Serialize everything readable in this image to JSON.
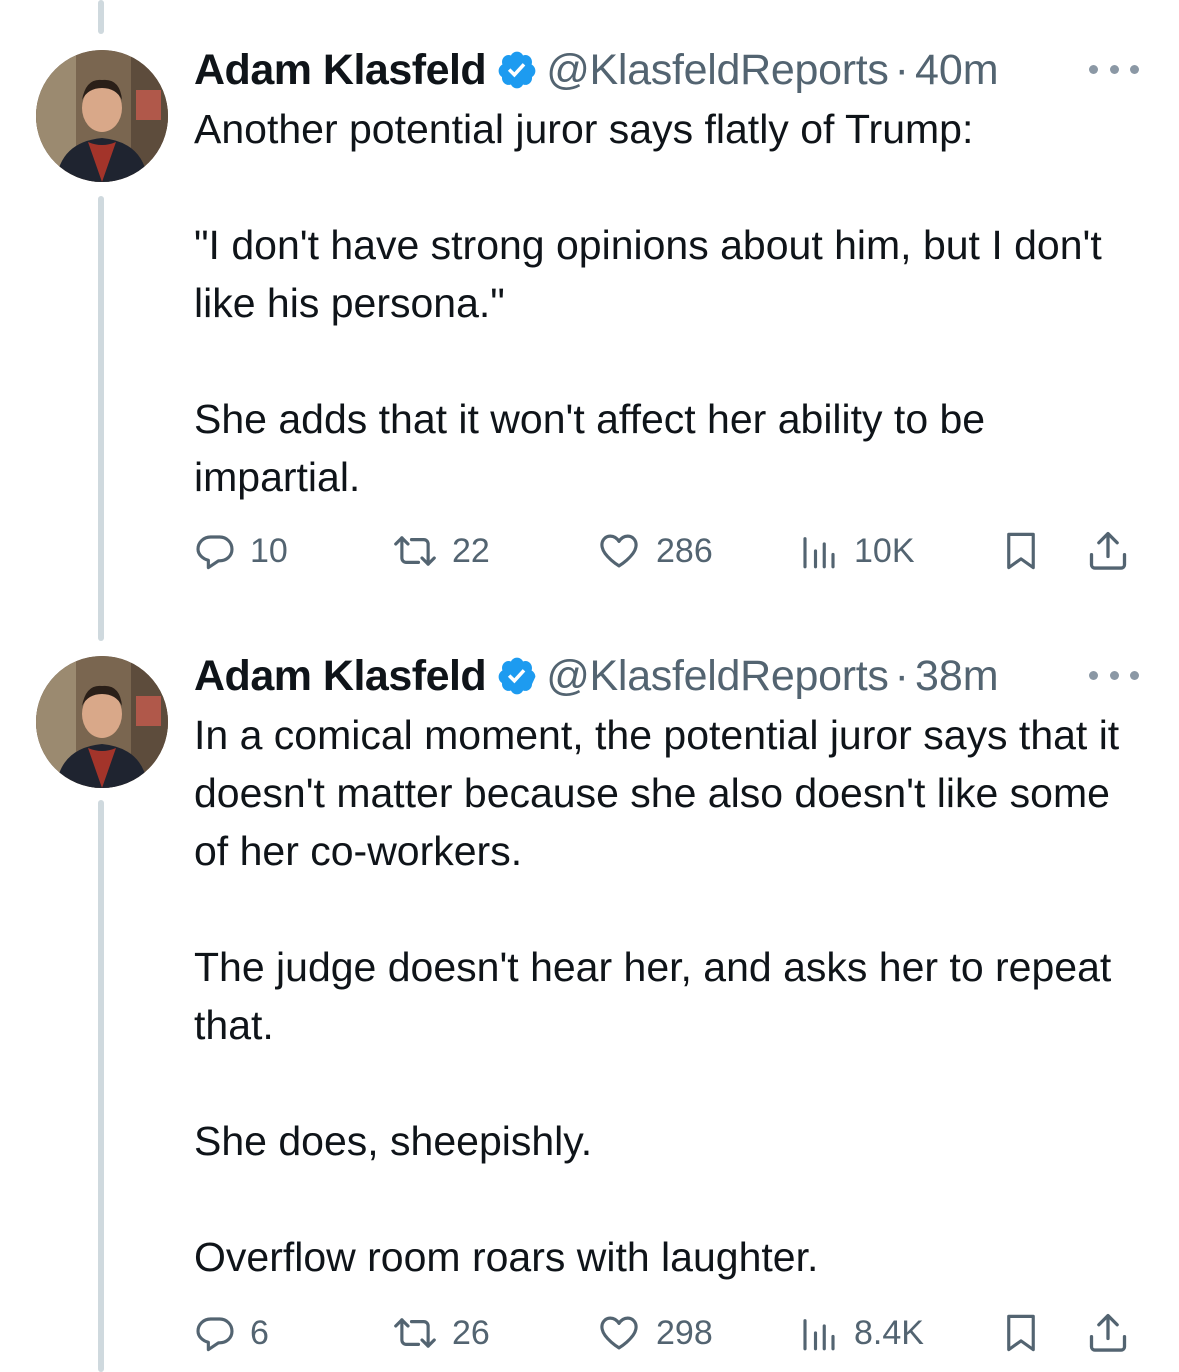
{
  "tweets": [
    {
      "author": "Adam Klasfeld",
      "handle": "@KlasfeldReports",
      "separator": "·",
      "time": "40m",
      "paragraphs": [
        "Another potential juror says flatly of Trump:",
        "\"I don't have strong opinions about him, but I don't like his persona.\"",
        "She adds that it won't affect her ability to be impartial."
      ],
      "replies": "10",
      "reposts": "22",
      "likes": "286",
      "views": "10K"
    },
    {
      "author": "Adam Klasfeld",
      "handle": "@KlasfeldReports",
      "separator": "·",
      "time": "38m",
      "paragraphs": [
        "In a comical moment, the potential juror says that it doesn't matter because she also doesn't like some of her co-workers.",
        "The judge doesn't hear her, and asks her to repeat that.",
        "She does, sheepishly.",
        "Overflow room roars with laughter."
      ],
      "replies": "6",
      "reposts": "26",
      "likes": "298",
      "views": "8.4K"
    }
  ],
  "icons": {
    "reply": "reply-icon",
    "repost": "repost-icon",
    "like": "heart-icon",
    "views": "views-icon",
    "bookmark": "bookmark-icon",
    "share": "share-icon",
    "verified": "verified-badge-icon",
    "more": "more-icon"
  },
  "colors": {
    "accent": "#1d9bf0",
    "secondary_text": "#536471",
    "thread_line": "#cfd9de"
  }
}
